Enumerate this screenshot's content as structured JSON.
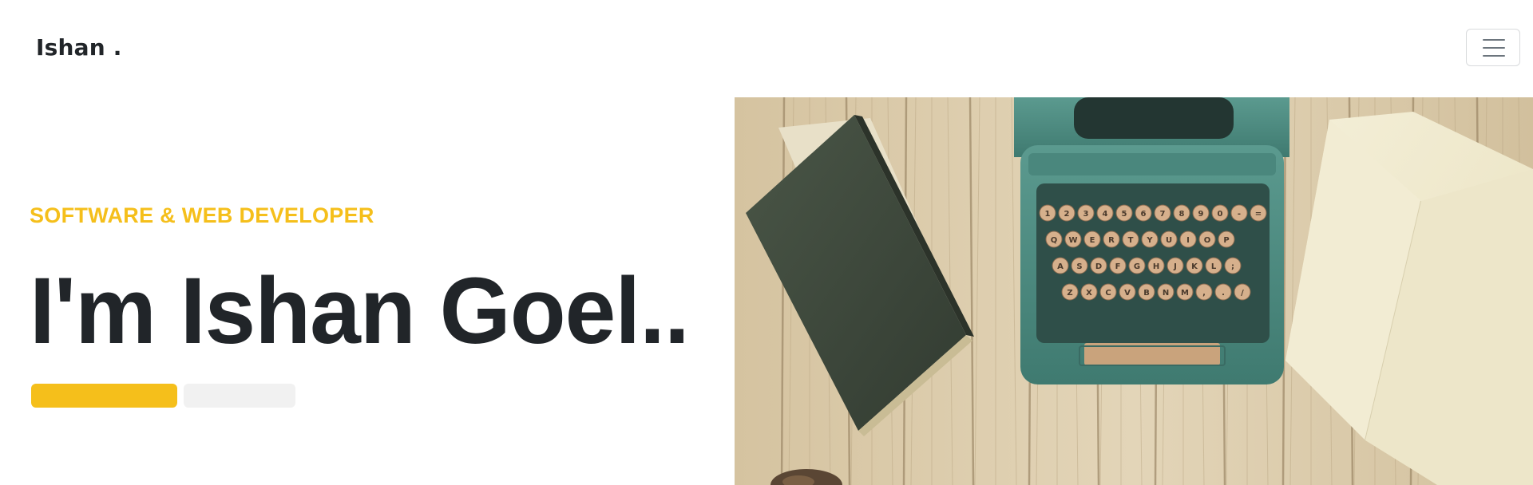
{
  "navbar": {
    "brand": "Ishan .",
    "menu_icon": "hamburger-menu-icon"
  },
  "hero": {
    "subtitle": "SOFTWARE & WEB DEVELOPER",
    "headline": "I'm Ishan Goel..",
    "primary_button_label": "",
    "secondary_button_label": "",
    "image": {
      "subject": "typewriter-with-book-and-notebook-on-wooden-desk",
      "keyboard_rows": [
        [
          "1",
          "2",
          "3",
          "4",
          "5",
          "6",
          "7",
          "8",
          "9",
          "0",
          "-",
          "="
        ],
        [
          "Q",
          "W",
          "E",
          "R",
          "T",
          "Y",
          "U",
          "I",
          "O",
          "P"
        ],
        [
          "A",
          "S",
          "D",
          "F",
          "G",
          "H",
          "J",
          "K",
          "L",
          ";"
        ],
        [
          "Z",
          "X",
          "C",
          "V",
          "B",
          "N",
          "M",
          ",",
          ".",
          "/"
        ]
      ]
    }
  },
  "colors": {
    "accent": "#f5bf1b",
    "text_dark": "#212529",
    "background": "#ffffff",
    "typewriter": "#4f8f84",
    "wood": "#d8c8a6",
    "book": "#3f4a3d",
    "notebook": "#f0ead0"
  }
}
